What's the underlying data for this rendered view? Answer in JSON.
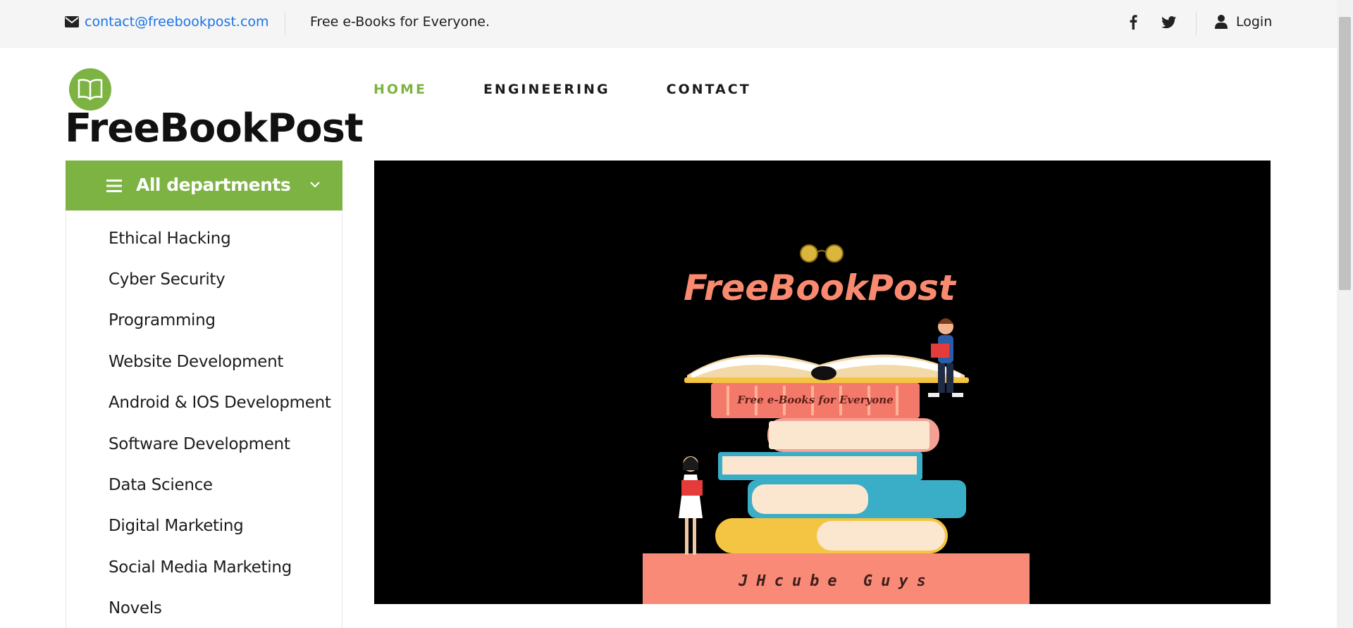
{
  "topbar": {
    "email": "contact@freebookpost.com",
    "tagline": "Free e-Books for Everyone.",
    "login_label": "Login",
    "icons": [
      "envelope-icon",
      "facebook-icon",
      "twitter-icon",
      "user-icon"
    ]
  },
  "logo": {
    "text": "FreeBookPost",
    "icon": "open-book-icon",
    "accent_color": "#7cb342"
  },
  "nav": {
    "items": [
      {
        "label": "HOME",
        "active": true
      },
      {
        "label": "ENGINEERING",
        "active": false
      },
      {
        "label": "CONTACT",
        "active": false
      }
    ]
  },
  "departments": {
    "title": "All departments",
    "items": [
      "Ethical Hacking",
      "Cyber Security",
      "Programming",
      "Website Development",
      "Android & IOS Development",
      "Software Development",
      "Data Science",
      "Digital Marketing",
      "Social Media Marketing",
      "Novels"
    ]
  },
  "hero": {
    "brand": "FreeBookPost",
    "book_label": "Free e-Books for Everyone",
    "base_label": "JHcube Guys",
    "colors": {
      "background": "#000000",
      "brand": "#fa8a6f",
      "base": "#fa8a78"
    }
  }
}
